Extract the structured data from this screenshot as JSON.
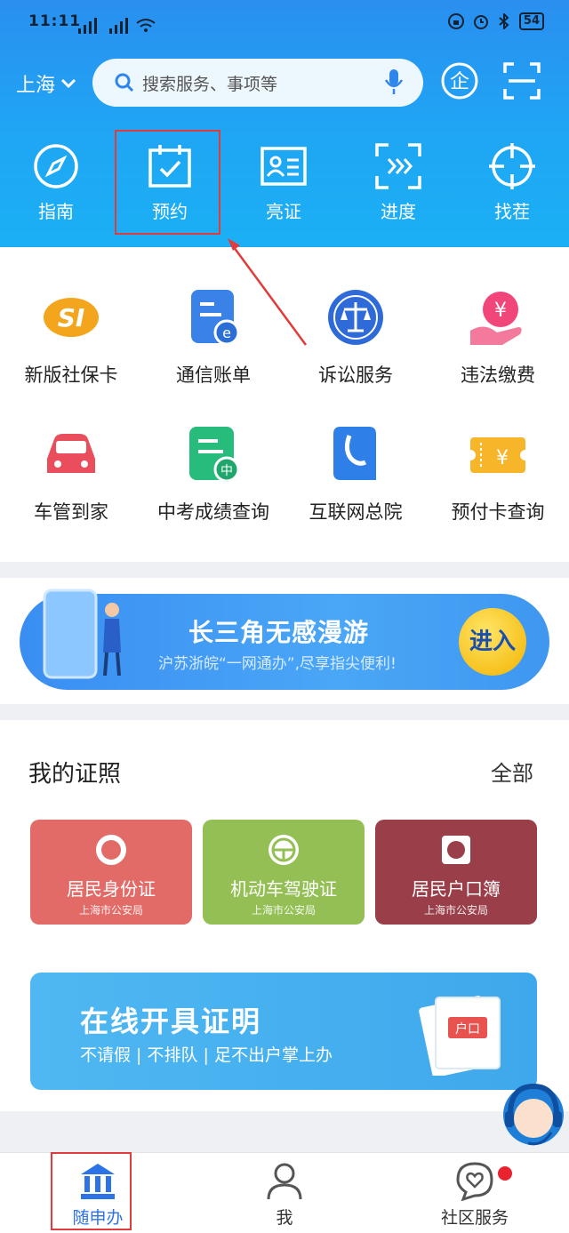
{
  "status": {
    "time": "11:11",
    "battery": "54"
  },
  "header": {
    "city": "上海",
    "search_placeholder": "搜索服务、事项等",
    "quick": [
      {
        "label": "指南",
        "icon": "compass-icon"
      },
      {
        "label": "预约",
        "icon": "calendar-check-icon"
      },
      {
        "label": "亮证",
        "icon": "id-card-icon"
      },
      {
        "label": "进度",
        "icon": "progress-scan-icon"
      },
      {
        "label": "找茬",
        "icon": "crosshair-icon"
      }
    ],
    "enterprise_icon_text": "企"
  },
  "grid": [
    {
      "label": "新版社保卡",
      "icon": "social-security-icon"
    },
    {
      "label": "通信账单",
      "icon": "telecom-bill-icon"
    },
    {
      "label": "诉讼服务",
      "icon": "court-scale-icon"
    },
    {
      "label": "违法缴费",
      "icon": "fine-payment-icon"
    },
    {
      "label": "车管到家",
      "icon": "car-icon"
    },
    {
      "label": "中考成绩查询",
      "icon": "exam-score-icon"
    },
    {
      "label": "互联网总院",
      "icon": "internet-hospital-icon"
    },
    {
      "label": "预付卡查询",
      "icon": "prepaid-card-icon"
    }
  ],
  "banner": {
    "title": "长三角无感漫游",
    "subtitle": "沪苏浙皖“一网通办”,尽享指尖便利!",
    "button": "进入"
  },
  "certs": {
    "title": "我的证照",
    "all": "全部",
    "cards": [
      {
        "name": "居民身份证",
        "org": "上海市公安局",
        "color": "#e26b68"
      },
      {
        "name": "机动车驾驶证",
        "org": "上海市公安局",
        "color": "#93bf55"
      },
      {
        "name": "居民户口簿",
        "org": "上海市公安局",
        "color": "#9a3f49"
      }
    ],
    "promo_title": "在线开具证明",
    "promo_sub": "不请假 | 不排队 | 足不出户掌上办",
    "promo_doc_text": "户口"
  },
  "tabs": [
    {
      "label": "随申办",
      "icon": "government-building-icon",
      "active": true
    },
    {
      "label": "我",
      "icon": "person-icon",
      "active": false
    },
    {
      "label": "社区服务",
      "icon": "heart-chat-icon",
      "active": false
    }
  ],
  "colors": {
    "header": "#2a8ff0",
    "active_tab": "#2d73e8",
    "highlight": "#e23b3b"
  }
}
